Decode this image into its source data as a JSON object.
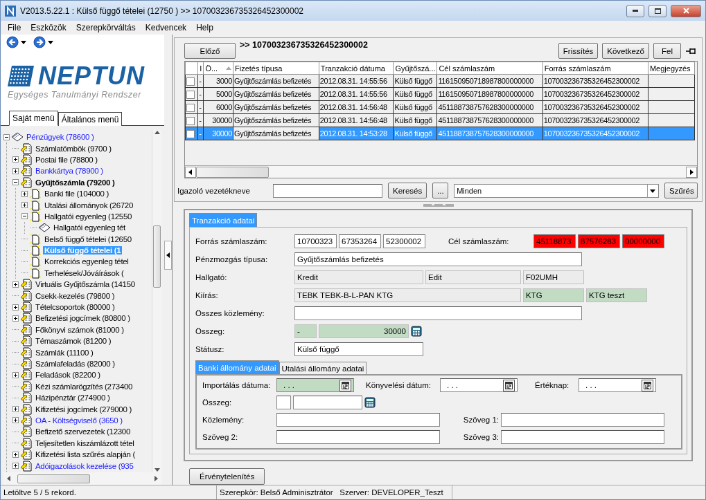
{
  "window": {
    "title": "V2013.5.22.1 : Külső függő tételei (12750  )  >> 107003236735326452300002"
  },
  "menu": [
    "File",
    "Eszközök",
    "Szerepkörváltás",
    "Kedvencek",
    "Help"
  ],
  "sidebar": {
    "logo": {
      "name": "NEPTUN",
      "tagline": "Egységes Tanulmányi Rendszer"
    },
    "tabs": [
      {
        "label": "Saját menü",
        "selected": true
      },
      {
        "label": "Általános menü",
        "selected": false
      }
    ],
    "tree": [
      {
        "label": "Pénzügyek (78600 )",
        "kind": "module",
        "link": true,
        "bold": false,
        "selected": false,
        "expanded": true,
        "children": [
          {
            "label": "Számlatömbök (9700 )",
            "kind": "section",
            "link": false,
            "bold": false,
            "selected": false
          },
          {
            "label": "Postai file (78800 )",
            "kind": "section",
            "link": false,
            "bold": false,
            "selected": false,
            "expanded": false
          },
          {
            "label": "Bankkártya (78900 )",
            "kind": "section",
            "link": true,
            "bold": false,
            "selected": false,
            "expanded": false
          },
          {
            "label": "Gyűjtőszámla (79200 )",
            "kind": "section",
            "link": false,
            "bold": true,
            "selected": false,
            "expanded": true,
            "children": [
              {
                "label": "Banki file (104000 )",
                "kind": "page",
                "link": false,
                "bold": false,
                "selected": false,
                "expanded": false
              },
              {
                "label": "Utalási állományok (26720",
                "kind": "page",
                "link": false,
                "bold": false,
                "selected": false,
                "expanded": false
              },
              {
                "label": "Hallgatói egyenleg (12550",
                "kind": "page",
                "link": false,
                "bold": false,
                "selected": false,
                "expanded": true,
                "children": [
                  {
                    "label": "Hallgatói egyenleg tét",
                    "kind": "module",
                    "link": false,
                    "bold": false,
                    "selected": false
                  }
                ]
              },
              {
                "label": "Belső függő tételei (12650",
                "kind": "page",
                "link": false,
                "bold": false,
                "selected": false
              },
              {
                "label": "Külső függő tételei (1",
                "kind": "page",
                "link": false,
                "bold": false,
                "selected": true
              },
              {
                "label": "Korrekciós egyenleg tétel",
                "kind": "page",
                "link": false,
                "bold": false,
                "selected": false
              },
              {
                "label": "Terhelések/Jóváírások (",
                "kind": "page",
                "link": false,
                "bold": false,
                "selected": false
              }
            ]
          },
          {
            "label": "Virtuális Gyűjtőszámla (14150",
            "kind": "section",
            "link": false,
            "bold": false,
            "selected": false,
            "expanded": false
          },
          {
            "label": "Csekk-kezelés (79800 )",
            "kind": "section",
            "link": false,
            "bold": false,
            "selected": false
          },
          {
            "label": "Tételcsoportok (80000 )",
            "kind": "section",
            "link": false,
            "bold": false,
            "selected": false,
            "expanded": false
          },
          {
            "label": "Befizetési jogcímek (80800 )",
            "kind": "section",
            "link": false,
            "bold": false,
            "selected": false,
            "expanded": false
          },
          {
            "label": "Főkönyvi számok (81000 )",
            "kind": "section",
            "link": false,
            "bold": false,
            "selected": false
          },
          {
            "label": "Témaszámok (81200 )",
            "kind": "section",
            "link": false,
            "bold": false,
            "selected": false
          },
          {
            "label": "Számlák (11100 )",
            "kind": "section",
            "link": false,
            "bold": false,
            "selected": false
          },
          {
            "label": "Számlafeladás (82000 )",
            "kind": "section",
            "link": false,
            "bold": false,
            "selected": false
          },
          {
            "label": "Feladások (82200 )",
            "kind": "section",
            "link": false,
            "bold": false,
            "selected": false,
            "expanded": false
          },
          {
            "label": "Kézi számlarögzítés (273400",
            "kind": "section",
            "link": false,
            "bold": false,
            "selected": false
          },
          {
            "label": "Házipénztár (274900 )",
            "kind": "section",
            "link": false,
            "bold": false,
            "selected": false
          },
          {
            "label": "Kifizetési jogcímek (279000 )",
            "kind": "section",
            "link": false,
            "bold": false,
            "selected": false,
            "expanded": false
          },
          {
            "label": "OA - Költségviselő (3650 )",
            "kind": "section",
            "link": true,
            "bold": false,
            "selected": false,
            "expanded": false
          },
          {
            "label": "Befizető szervezetek (12300",
            "kind": "section",
            "link": false,
            "bold": false,
            "selected": false
          },
          {
            "label": "Teljesítetlen kiszámlázott tétel",
            "kind": "section",
            "link": false,
            "bold": false,
            "selected": false
          },
          {
            "label": "Kifizetési lista szűrés alapján (",
            "kind": "section",
            "link": false,
            "bold": false,
            "selected": false,
            "expanded": false
          },
          {
            "label": "Adóigazolások kezelése (935",
            "kind": "section",
            "link": true,
            "bold": false,
            "selected": false,
            "expanded": false
          }
        ]
      }
    ]
  },
  "toolbar": {
    "previous": "Előző",
    "path": ">> 107003236735326452300002",
    "buttons": [
      "Frissítés",
      "Következő",
      "Fel"
    ]
  },
  "table": {
    "columns": [
      "I",
      "Ö...",
      "Fizetés típusa",
      "Tranzakció dátuma",
      "Gyűjtőszá...",
      "Cél számlaszám",
      "Forrás számlaszám",
      "Megjegyzés"
    ],
    "rows": [
      {
        "selected": false,
        "checked": false,
        "cells": [
          "-",
          "3000",
          "Gyűjtőszámlás befizetés",
          "2012.08.31. 14:55:56",
          "Külső függő",
          "116150950718987800000000",
          "107003236735326452300002"
        ]
      },
      {
        "selected": false,
        "checked": false,
        "cells": [
          "-",
          "5000",
          "Gyűjtőszámlás befizetés",
          "2012.08.31. 14:55:56",
          "Külső függő",
          "116150950718987800000000",
          "107003236735326452300002"
        ]
      },
      {
        "selected": false,
        "checked": false,
        "cells": [
          "-",
          "6000",
          "Gyűjtőszámlás befizetés",
          "2012.08.31. 14:56:48",
          "Külső függő",
          "451188738757628300000000",
          "107003236735326452300002"
        ]
      },
      {
        "selected": false,
        "checked": false,
        "cells": [
          "-",
          "30000",
          "Gyűjtőszámlás befizetés",
          "2012.08.31. 14:56:48",
          "Külső függő",
          "451188738757628300000000",
          "107003236735326452300002"
        ]
      },
      {
        "selected": true,
        "checked": false,
        "cells": [
          "-",
          "30000",
          "Gyűjtőszámlás befizetés",
          "2012.08.31. 14:53:28",
          "Külső függő",
          "451188738757628300000000",
          "107003236735326452300002"
        ]
      }
    ]
  },
  "filter": {
    "label": "Igazoló vezetékneve",
    "search": "Keresés",
    "more": "...",
    "select": "Minden",
    "apply": "Szűrés"
  },
  "form": {
    "tabs": [
      {
        "label": "Tranzakció adatai",
        "selected": true
      }
    ],
    "source_account": {
      "label": "Forrás számlaszám:",
      "parts": [
        "10700323",
        "67353264",
        "52300002"
      ]
    },
    "target_account": {
      "label": "Cél számlaszám:",
      "invalid": true,
      "parts": [
        "45118873",
        "87576283",
        "00000000"
      ]
    },
    "movement_type": {
      "label": "Pénzmozgás típusa:",
      "value": "Gyűjtőszámlás befizetés"
    },
    "student": {
      "label": "Hallgató:",
      "parts": [
        "Kredit",
        "Edit",
        "F02UMH"
      ]
    },
    "announcement": {
      "label": "Kiírás:",
      "parts": [
        {
          "value": "TEBK TEBK-B-L-PAN KTG",
          "highlighted": false
        },
        {
          "value": "KTG",
          "highlighted": true
        },
        {
          "value": "KTG teszt",
          "highlighted": true
        }
      ]
    },
    "total_comment": {
      "label": "Összes közlemény:"
    },
    "amount": {
      "label": "Összeg:",
      "sign": "-",
      "value": "30000",
      "highlighted": true
    },
    "status": {
      "label": "Státusz:",
      "value": "Külső függő"
    }
  },
  "bank": {
    "tabs": [
      {
        "label": "Banki állomány adatai",
        "selected": true
      },
      {
        "label": "Utalási állomány adatai",
        "selected": false
      }
    ],
    "dates": [
      {
        "label": "Importálás dátuma:",
        "value": ". . .",
        "highlighted": true
      },
      {
        "label": "Könyvelési dátum:",
        "value": ". . .",
        "highlighted": false
      },
      {
        "label": "Értéknap:",
        "value": ". . .",
        "highlighted": false
      }
    ],
    "amount": {
      "label": "Összeg:"
    },
    "texts": [
      {
        "label": "Közlemény:"
      },
      {
        "label": "Szöveg 1:"
      },
      {
        "label": "Szöveg 2:"
      },
      {
        "label": "Szöveg 3:"
      }
    ]
  },
  "actions": {
    "invalidate": "Érvénytelenítés"
  },
  "status_bar": {
    "records": "Letöltve 5 / 5 rekord.",
    "role": "Szerepkör: Belső Adminisztrátor",
    "server": "Szerver: DEVELOPER_Teszt"
  }
}
